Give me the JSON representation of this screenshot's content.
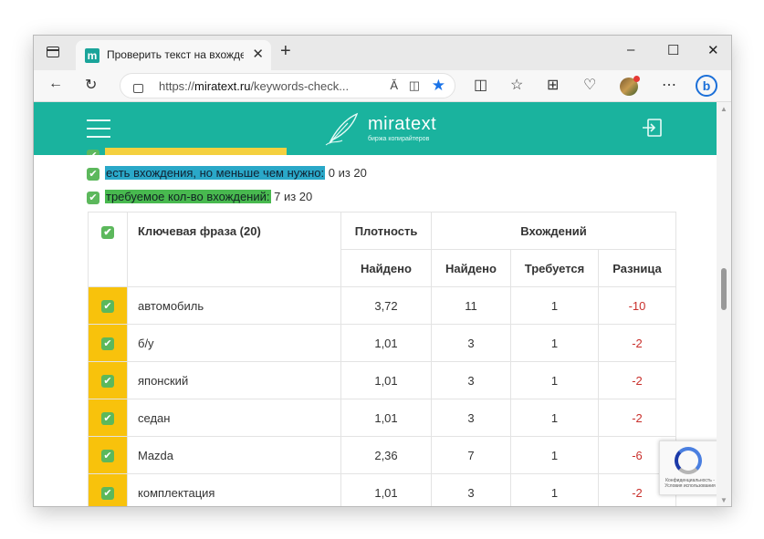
{
  "browser": {
    "tab_title": "Проверить текст на вхождение",
    "tab_close": "✕",
    "new_tab": "+",
    "window_controls": {
      "minimize": "–",
      "maximize": "☐",
      "close": "✕"
    },
    "url_prefix": "https://",
    "url_domain": "miratext.ru",
    "url_path": "/keywords-check...",
    "read_aloud": "Ă",
    "profile_dot_color": "#e53935"
  },
  "site": {
    "brand": "miratext",
    "tagline": "биржа копирайтеров",
    "accent_color": "#1ab39e"
  },
  "legend": [
    {
      "highlight": "есть вхождения, но меньше чем нужно:",
      "count": " 0 из 20",
      "color": "#2aa8c8"
    },
    {
      "highlight": "требуемое кол-во вхождений:",
      "count": " 7 из 20",
      "color": "#48b94f"
    }
  ],
  "table": {
    "header": {
      "phrase": "Ключевая фраза (20)",
      "density": "Плотность",
      "occurrences": "Вхождений",
      "found_density": "Найдено",
      "found": "Найдено",
      "required": "Требуется",
      "difference": "Разница"
    },
    "rows": [
      {
        "phrase": "автомобиль",
        "density": "3,72",
        "found": "11",
        "required": "1",
        "diff": "-10"
      },
      {
        "phrase": "б/у",
        "density": "1,01",
        "found": "3",
        "required": "1",
        "diff": "-2"
      },
      {
        "phrase": "японский",
        "density": "1,01",
        "found": "3",
        "required": "1",
        "diff": "-2"
      },
      {
        "phrase": "седан",
        "density": "1,01",
        "found": "3",
        "required": "1",
        "diff": "-2"
      },
      {
        "phrase": "Mazda",
        "density": "2,36",
        "found": "7",
        "required": "1",
        "diff": "-6"
      },
      {
        "phrase": "комплектация",
        "density": "1,01",
        "found": "3",
        "required": "1",
        "diff": "-2"
      }
    ]
  },
  "recaptcha": {
    "text": "Конфиденциальность - Условия использования"
  }
}
